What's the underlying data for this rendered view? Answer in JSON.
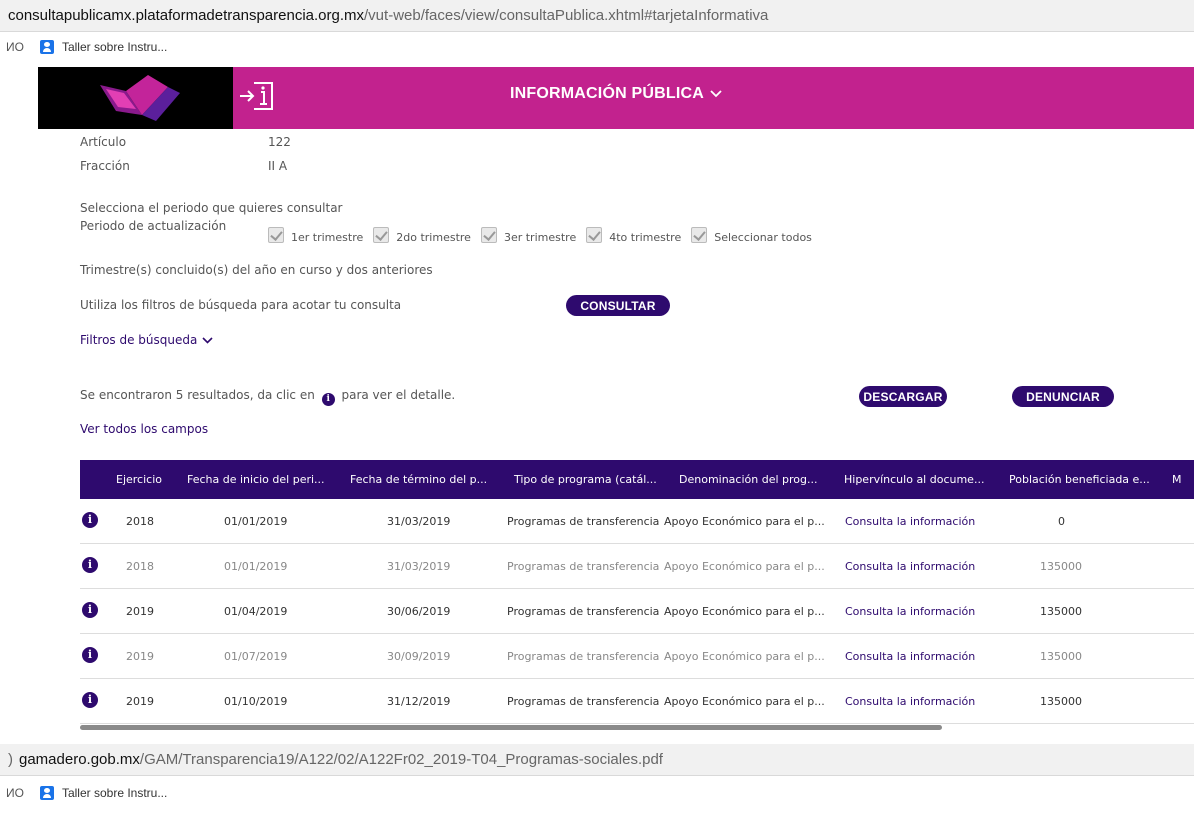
{
  "browser": {
    "url1_host": "consultapublicamx.plataformadetransparencia.org.mx",
    "url1_path": "/vut-web/faces/view/consultaPublica.xhtml#tarjetaInformativa",
    "url2_prefix": ")",
    "url2_host": "gamadero.gob.mx",
    "url2_path": "/GAM/Transparencia19/A122/02/A122Fr02_2019-T04_Programas-sociales.pdf",
    "bookmark_cut": "ИO",
    "bookmark_label": "Taller sobre Instru..."
  },
  "header": {
    "nav_title": "INFORMACIÓN PÚBLICA",
    "color": "#c2228e"
  },
  "info": {
    "articulo_label": "Artículo",
    "articulo_value": "122",
    "fraccion_label": "Fracción",
    "fraccion_value": "II A"
  },
  "period": {
    "prompt": "Selecciona el periodo que quieres consultar",
    "label": "Periodo de actualización",
    "options": [
      "1er trimestre",
      "2do trimestre",
      "3er trimestre",
      "4to trimestre",
      "Seleccionar todos"
    ],
    "note": "Trimestre(s) concluido(s) del año en curso y dos anteriores"
  },
  "filters": {
    "hint": "Utiliza los filtros de búsqueda para acotar tu consulta",
    "consultar": "CONSULTAR",
    "toggle": "Filtros de búsqueda"
  },
  "results": {
    "text_before": "Se encontraron 5 resultados, da clic en",
    "text_after": "para ver el detalle.",
    "descargar": "DESCARGAR",
    "denunciar": "DENUNCIAR",
    "ver_todos": "Ver todos los campos"
  },
  "table": {
    "headers": [
      "Ejercicio",
      "Fecha de inicio del peri...",
      "Fecha de término del p...",
      "Tipo de programa (catál...",
      "Denominación del prog...",
      "Hipervínculo al docume...",
      "Población beneficiada e...",
      "M"
    ],
    "rows": [
      [
        "2018",
        "01/01/2019",
        "31/03/2019",
        "Programas de transferencia",
        "Apoyo Económico para el p...",
        "Consulta la información",
        "0"
      ],
      [
        "2018",
        "01/01/2019",
        "31/03/2019",
        "Programas de transferencia",
        "Apoyo Económico para el p...",
        "Consulta la información",
        "135000"
      ],
      [
        "2019",
        "01/04/2019",
        "30/06/2019",
        "Programas de transferencia",
        "Apoyo Económico para el p...",
        "Consulta la información",
        "135000"
      ],
      [
        "2019",
        "01/07/2019",
        "30/09/2019",
        "Programas de transferencia",
        "Apoyo Económico para el p...",
        "Consulta la información",
        "135000"
      ],
      [
        "2019",
        "01/10/2019",
        "31/12/2019",
        "Programas de transferencia",
        "Apoyo Económico para el p...",
        "Consulta la información",
        "135000"
      ]
    ]
  },
  "colors": {
    "primary": "#2e0a6e",
    "header": "#c2228e"
  }
}
